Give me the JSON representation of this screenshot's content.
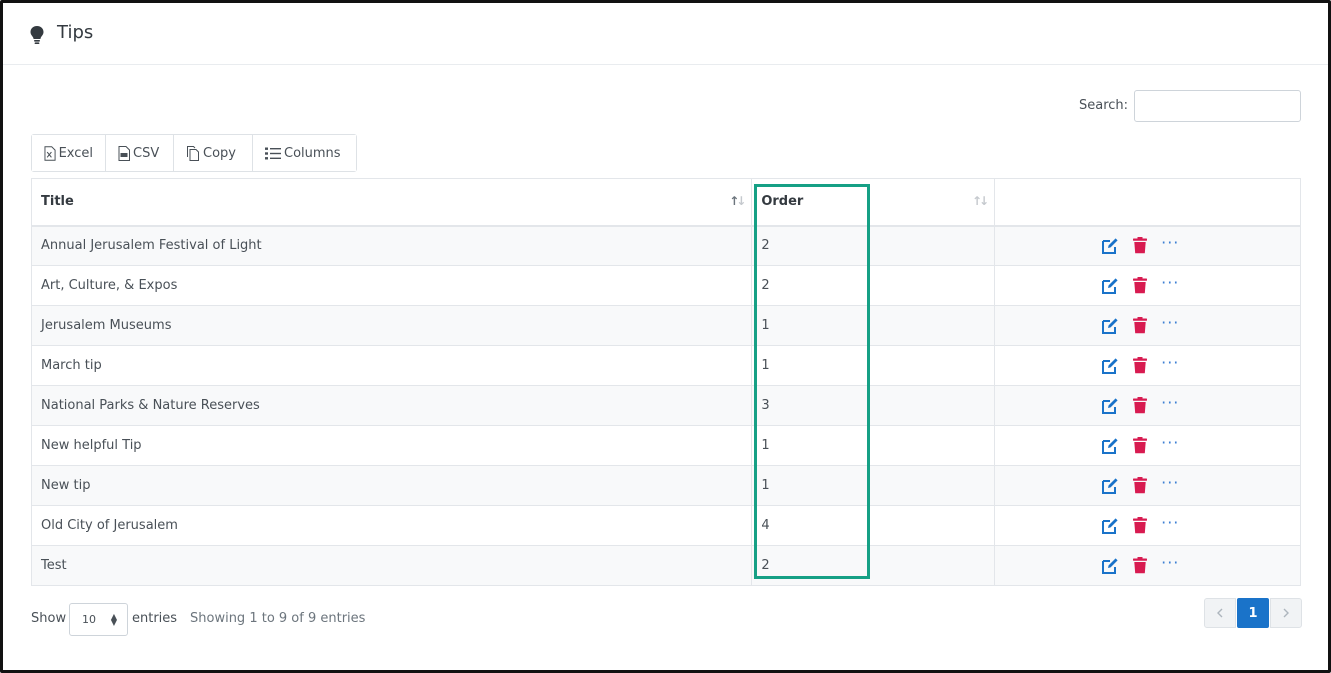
{
  "header": {
    "title": "Tips",
    "icon": "lightbulb-icon"
  },
  "search": {
    "label": "Search:",
    "value": "",
    "placeholder": ""
  },
  "toolbar": {
    "excel_label": "Excel",
    "csv_label": "CSV",
    "copy_label": "Copy",
    "columns_label": "Columns"
  },
  "table": {
    "columns": [
      "Title",
      "Order",
      ""
    ],
    "rows": [
      {
        "title": "Annual Jerusalem Festival of Light",
        "order": "2"
      },
      {
        "title": "Art, Culture, & Expos",
        "order": "2"
      },
      {
        "title": "Jerusalem Museums",
        "order": "1"
      },
      {
        "title": "March tip",
        "order": "1"
      },
      {
        "title": "National Parks & Nature Reserves",
        "order": "3"
      },
      {
        "title": "New helpful Tip",
        "order": "1"
      },
      {
        "title": "New tip",
        "order": "1"
      },
      {
        "title": "Old City of Jerusalem",
        "order": "4"
      },
      {
        "title": "Test",
        "order": "2"
      }
    ]
  },
  "footer": {
    "show_label": "Show",
    "page_length": "10",
    "entries_label": "entries",
    "info": "Showing 1 to 9 of 9 entries",
    "current_page": "1"
  },
  "colors": {
    "accent": "#1a73c9",
    "edit": "#1a73c9",
    "delete": "#d81b50",
    "highlight": "#16a085"
  }
}
